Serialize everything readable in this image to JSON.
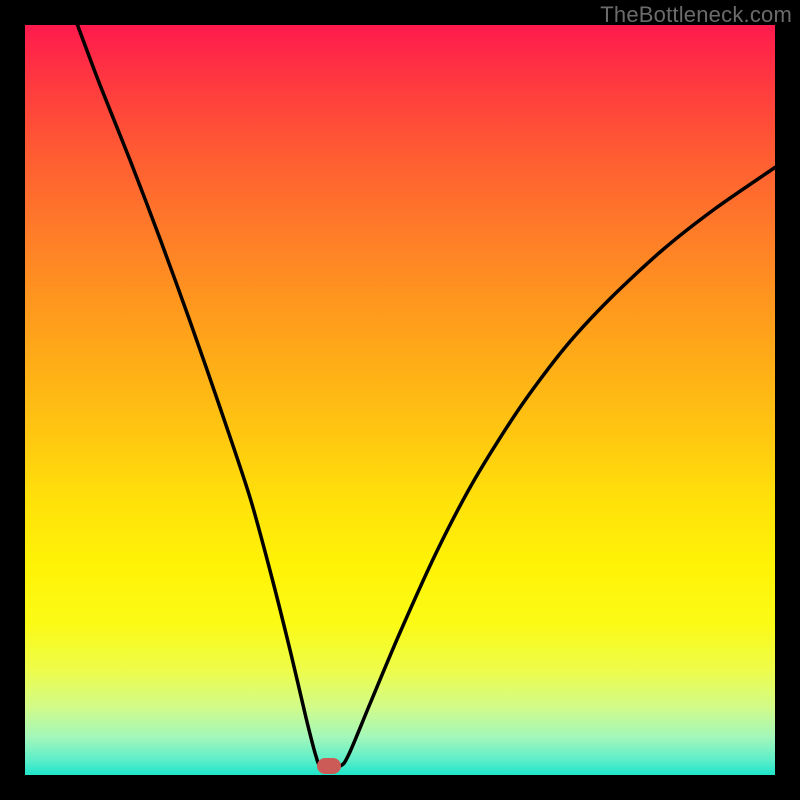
{
  "watermark": "TheBottleneck.com",
  "chart_data": {
    "type": "line",
    "title": "",
    "xlabel": "",
    "ylabel": "",
    "xlim": [
      0,
      100
    ],
    "ylim": [
      0,
      100
    ],
    "grid": false,
    "legend": false,
    "annotations": [],
    "marker": {
      "x": 40.5,
      "y": 1.2
    },
    "series": [
      {
        "name": "curve",
        "points": [
          {
            "x": 7.0,
            "y": 100.0
          },
          {
            "x": 10.0,
            "y": 92.0
          },
          {
            "x": 14.0,
            "y": 82.0
          },
          {
            "x": 18.0,
            "y": 71.5
          },
          {
            "x": 22.0,
            "y": 60.5
          },
          {
            "x": 26.0,
            "y": 49.0
          },
          {
            "x": 30.0,
            "y": 37.0
          },
          {
            "x": 33.0,
            "y": 26.0
          },
          {
            "x": 35.5,
            "y": 16.0
          },
          {
            "x": 37.5,
            "y": 7.5
          },
          {
            "x": 38.8,
            "y": 2.5
          },
          {
            "x": 39.5,
            "y": 1.2
          },
          {
            "x": 42.0,
            "y": 1.2
          },
          {
            "x": 43.2,
            "y": 2.8
          },
          {
            "x": 46.0,
            "y": 9.5
          },
          {
            "x": 50.0,
            "y": 19.0
          },
          {
            "x": 55.0,
            "y": 30.0
          },
          {
            "x": 60.0,
            "y": 39.5
          },
          {
            "x": 66.0,
            "y": 49.0
          },
          {
            "x": 72.0,
            "y": 57.0
          },
          {
            "x": 78.0,
            "y": 63.5
          },
          {
            "x": 85.0,
            "y": 70.0
          },
          {
            "x": 92.0,
            "y": 75.5
          },
          {
            "x": 100.0,
            "y": 81.0
          }
        ]
      }
    ],
    "background_gradient": {
      "top_color": "#ff1a4d",
      "bottom_color": "#1de5c9",
      "description": "red-orange-yellow-green vertical gradient"
    }
  }
}
